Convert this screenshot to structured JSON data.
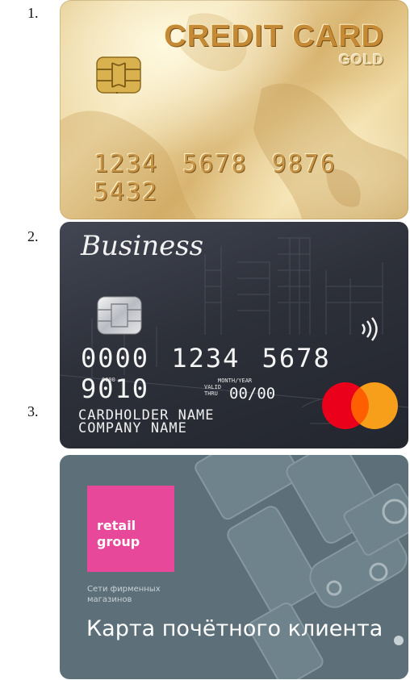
{
  "labels": {
    "n1": "1.",
    "n2": "2.",
    "n3": "3."
  },
  "card1": {
    "title": "CREDIT CARD",
    "subtitle": "GOLD",
    "number": "1234 5678 9876 5432"
  },
  "card2": {
    "brand": "Business",
    "number": "0000 1234 5678 9010",
    "first_digits": "0000",
    "month_year": "MONTH/YEAR",
    "valid": "VALID",
    "thru": "THRU",
    "expiry": "00/00",
    "cardholder": "CARDHOLDER NAME",
    "company": "COMPANY NAME",
    "colors": {
      "mc_red": "#eb001b",
      "mc_orange": "#f79e1b"
    }
  },
  "card3": {
    "logo_line1": "retail",
    "logo_line2": "group",
    "sub_line1": "Сети фирменных",
    "sub_line2": "магазинов",
    "label": "Карта почётного клиента",
    "colors": {
      "background": "#5d7079",
      "logo": "#e8489a"
    }
  }
}
